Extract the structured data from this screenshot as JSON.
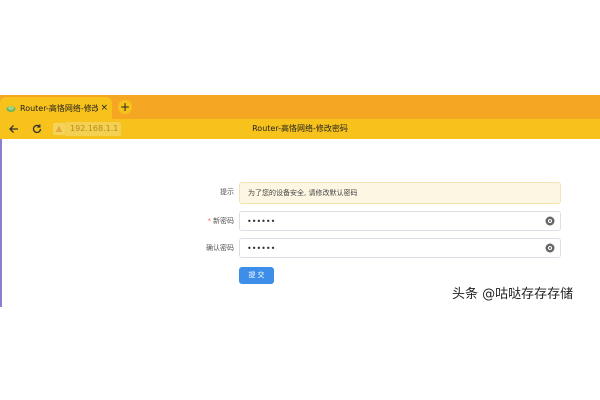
{
  "browser": {
    "tab_title": "Router-高恪网络-修改密",
    "tab_close": "×",
    "new_tab": "+",
    "address": "192.168.1.1",
    "page_title": "Router-高恪网络-修改密码"
  },
  "form": {
    "hint_label": "提示",
    "hint_text": "为了您的设备安全, 请修改默认密码",
    "required_mark": "*",
    "new_password_label": "新密码",
    "new_password_value": "••••••",
    "confirm_password_label": "确认密码",
    "confirm_password_value": "••••••",
    "submit_label": "提 交"
  },
  "watermark": "头条 @咕哒存存存储",
  "colors": {
    "tab_bar": "#f5a623",
    "toolbar": "#f8c21c",
    "submit": "#3d8ee8",
    "hint_bg": "#fdf6e3",
    "required": "#f56c6c"
  }
}
